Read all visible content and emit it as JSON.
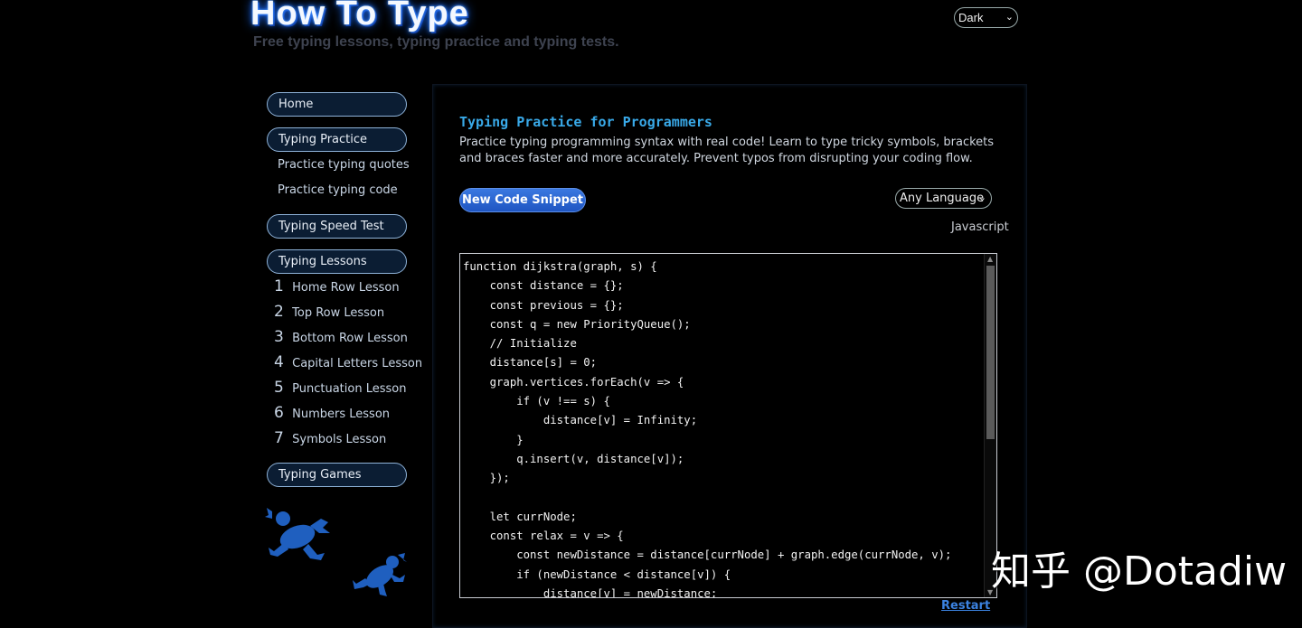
{
  "header": {
    "logo": "How To Type",
    "tagline": "Free typing lessons, typing practice and typing tests.",
    "theme_select": "Dark"
  },
  "sidebar": {
    "home": "Home",
    "typing_practice": "Typing Practice",
    "practice_quotes": "Practice typing quotes",
    "practice_code": "Practice typing code",
    "speed_test": "Typing Speed Test",
    "typing_lessons": "Typing Lessons",
    "lessons": [
      {
        "num": "1",
        "label": "Home Row Lesson"
      },
      {
        "num": "2",
        "label": "Top Row Lesson"
      },
      {
        "num": "3",
        "label": "Bottom Row Lesson"
      },
      {
        "num": "4",
        "label": "Capital Letters Lesson"
      },
      {
        "num": "5",
        "label": "Punctuation Lesson"
      },
      {
        "num": "6",
        "label": "Numbers Lesson"
      },
      {
        "num": "7",
        "label": "Symbols Lesson"
      }
    ],
    "typing_games": "Typing Games"
  },
  "main": {
    "title": "Typing Practice for Programmers",
    "description": "Practice typing programming syntax with real code! Learn to type tricky symbols, brackets and braces faster and more accurately. Prevent typos from disrupting your coding flow.",
    "new_snippet_button": "New Code Snippet",
    "language_select": "Any Language",
    "language_label": "Javascript",
    "code": "function dijkstra(graph, s) {\n    const distance = {};\n    const previous = {};\n    const q = new PriorityQueue();\n    // Initialize\n    distance[s] = 0;\n    graph.vertices.forEach(v => {\n        if (v !== s) {\n            distance[v] = Infinity;\n        }\n        q.insert(v, distance[v]);\n    });\n\n    let currNode;\n    const relax = v => {\n        const newDistance = distance[currNode] + graph.edge(currNode, v);\n        if (newDistance < distance[v]) {\n            distance[v] = newDistance;",
    "restart_link": "Restart"
  },
  "watermark": "知乎 @Dotadiw",
  "colors": {
    "background": "#000000",
    "accent_title": "#39a9e8",
    "button_blue": "#2a63d0",
    "frog_blue": "#1f5fbf"
  }
}
